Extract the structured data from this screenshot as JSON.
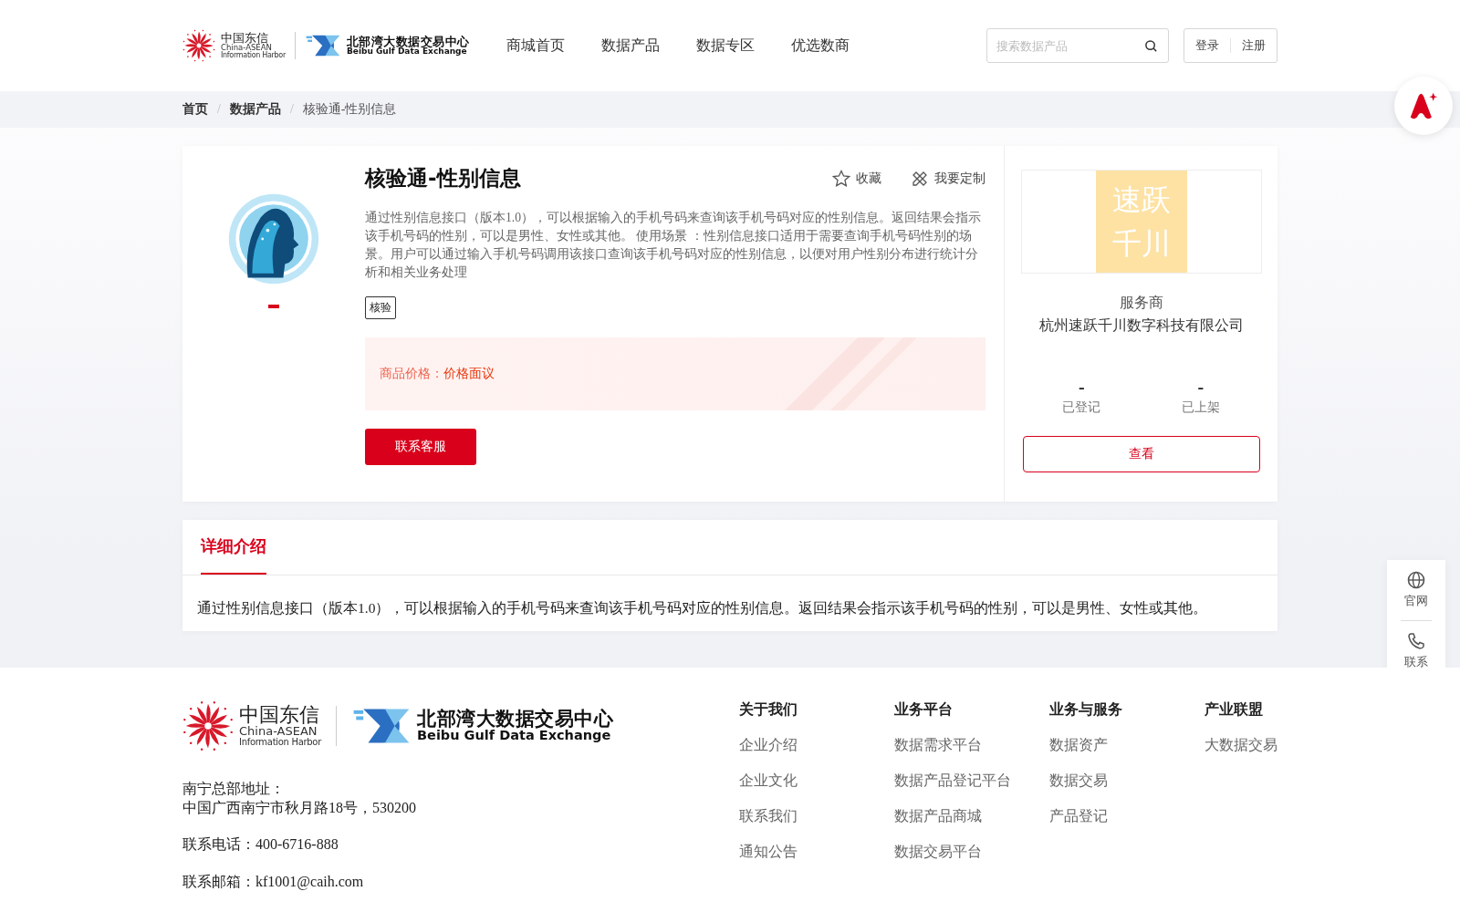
{
  "header": {
    "logo": {
      "cn_name": "中国东信",
      "en_name": "China-ASEAN",
      "en_sub": "Information Harbor",
      "exchange_cn": "北部湾大数据交易中心",
      "exchange_en": "Beibu Gulf Data Exchange"
    },
    "nav": [
      {
        "label": "商城首页",
        "selected": false
      },
      {
        "label": "数据产品",
        "selected": false
      },
      {
        "label": "数据专区",
        "selected": false
      },
      {
        "label": "优选数商",
        "selected": false
      }
    ],
    "search": {
      "placeholder": "搜索数据产品"
    },
    "auth": [
      "登录",
      "注册"
    ]
  },
  "breadcrumb": [
    {
      "kind": "link",
      "text": "首页"
    },
    {
      "kind": "separator",
      "text": "/"
    },
    {
      "kind": "link",
      "text": "数据产品"
    },
    {
      "kind": "separator",
      "text": "/"
    },
    {
      "kind": "current",
      "text": "核验通-性别信息"
    }
  ],
  "product": {
    "title": "核验通-性别信息",
    "actions": [
      "收藏",
      "我要定制"
    ],
    "description": "通过性别信息接口（版本1.0），可以根据输入的手机号码来查询该手机号码对应的性别信息。返回结果会指示该手机号码的性别，可以是男性、女性或其他。 使用场景 ：性别信息接口适用于需要查询手机号码性别的场景。用户可以通过输入手机号码调用该接口查询该手机号码对应的性别信息，以便对用户性别分布进行统计分析和相关业务处理",
    "tags": [
      "核验"
    ],
    "price_label": "商品价格：",
    "price_value": "价格面议",
    "contact_button": "联系客服"
  },
  "provider": {
    "logo_text": [
      "速跃",
      "千川"
    ],
    "role": "服务商",
    "name": "杭州速跃千川数字科技有限公司",
    "stats": [
      {
        "value": "-",
        "label": "已登记"
      },
      {
        "value": "-",
        "label": "已上架"
      }
    ],
    "view_button": "查看"
  },
  "details": {
    "tabs": [
      {
        "label": "详细介绍",
        "selected": true
      }
    ],
    "text": "通过性别信息接口（版本1.0），可以根据输入的手机号码来查询该手机号码对应的性别信息。返回结果会指示该手机号码的性别，可以是男性、女性或其他。"
  },
  "side_tools": [
    {
      "kind": "globe",
      "label": "官网"
    },
    {
      "kind": "phone",
      "label": "联系"
    }
  ],
  "footer": {
    "logo": {
      "cn_name": "中国东信",
      "en_name": "China-ASEAN",
      "en_sub": "Information Harbor",
      "exchange_cn": "北部湾大数据交易中心",
      "exchange_en": "Beibu Gulf Data Exchange"
    },
    "address_label": "南宁总部地址：",
    "address": "中国广西南宁市秋月路18号，530200",
    "phone": "联系电话：400-6716-888",
    "email": "联系邮箱：kf1001@caih.com",
    "columns": [
      {
        "title": "关于我们",
        "links": [
          "企业介绍",
          "企业文化",
          "联系我们",
          "通知公告"
        ]
      },
      {
        "title": "业务平台",
        "links": [
          "数据需求平台",
          "数据产品登记平台",
          "数据产品商城",
          "数据交易平台"
        ]
      },
      {
        "title": "业务与服务",
        "links": [
          "数据资产",
          "数据交易",
          "产品登记"
        ]
      },
      {
        "title": "产业联盟",
        "links": [
          "大数据交易"
        ]
      }
    ]
  }
}
